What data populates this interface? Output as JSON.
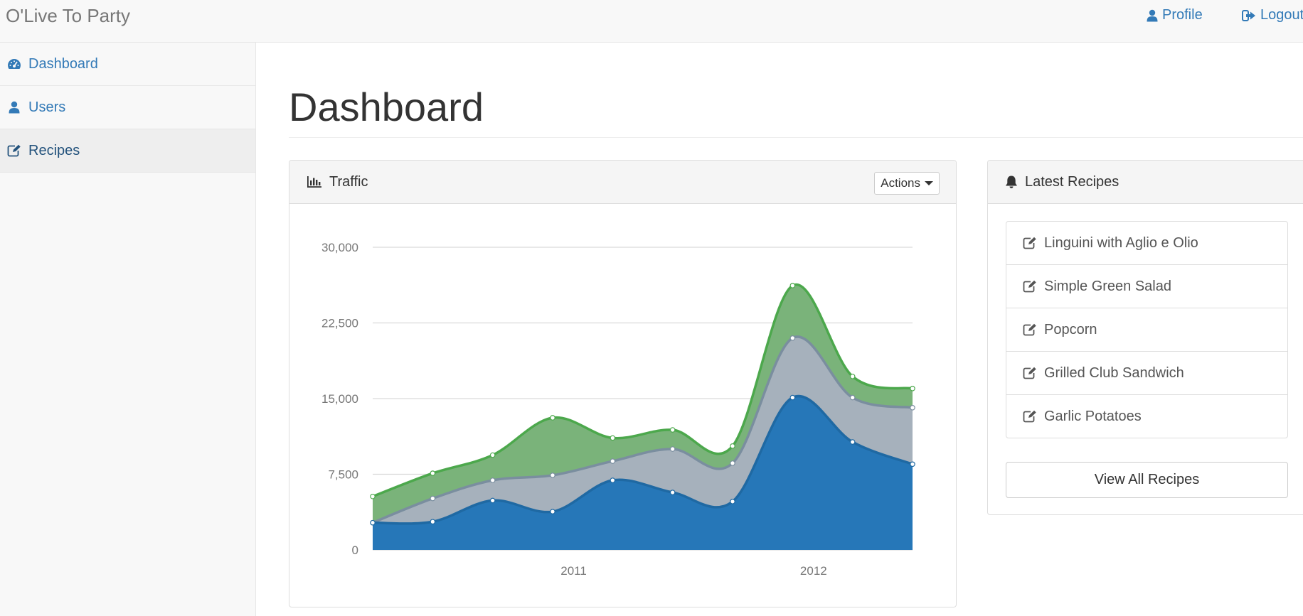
{
  "navbar": {
    "brand": "O'Live To Party",
    "profile_label": "Profile",
    "logout_label": "Logout"
  },
  "sidebar": {
    "items": [
      {
        "label": "Dashboard",
        "icon": "dashboard-icon"
      },
      {
        "label": "Users",
        "icon": "user-icon"
      },
      {
        "label": "Recipes",
        "icon": "edit-icon",
        "active": true
      }
    ]
  },
  "page": {
    "title": "Dashboard"
  },
  "traffic_panel": {
    "title": "Traffic",
    "icon": "bar-chart-icon",
    "actions_label": "Actions"
  },
  "recipes_panel": {
    "title": "Latest Recipes",
    "icon": "bell-icon",
    "items": [
      "Linguini with Aglio e Olio",
      "Simple Green Salad",
      "Popcorn",
      "Grilled Club Sandwich",
      "Garlic Potatoes"
    ],
    "view_all_label": "View All Recipes"
  },
  "colors": {
    "link": "#337ab7",
    "series_blue": "#2677b8",
    "series_gray": "#a6b1bc",
    "series_green": "#7ab37a"
  },
  "chart_data": {
    "type": "area",
    "stacked": true,
    "y_ticks": [
      "0",
      "7,500",
      "15,000",
      "22,500",
      "30,000"
    ],
    "ylim": [
      0,
      30000
    ],
    "x_tick_labels": [
      {
        "label": "2011",
        "at": 3.35
      },
      {
        "label": "2012",
        "at": 7.35
      }
    ],
    "points": 10,
    "series": [
      {
        "values": [
          2700,
          2800,
          4900,
          3800,
          6900,
          5700,
          4800,
          15100,
          10700,
          8500
        ],
        "color": "#2677b8",
        "line": "#1f69a3"
      },
      {
        "values": [
          0,
          2300,
          2000,
          3600,
          1900,
          4300,
          3800,
          5900,
          4400,
          5600
        ],
        "color": "#a6b1bc",
        "line": "#7a8e9f"
      },
      {
        "values": [
          2600,
          2500,
          2500,
          5700,
          2300,
          1900,
          1700,
          5200,
          2100,
          1900
        ],
        "color": "#7ab37a",
        "line": "#4ca84c"
      }
    ],
    "grid": true
  }
}
